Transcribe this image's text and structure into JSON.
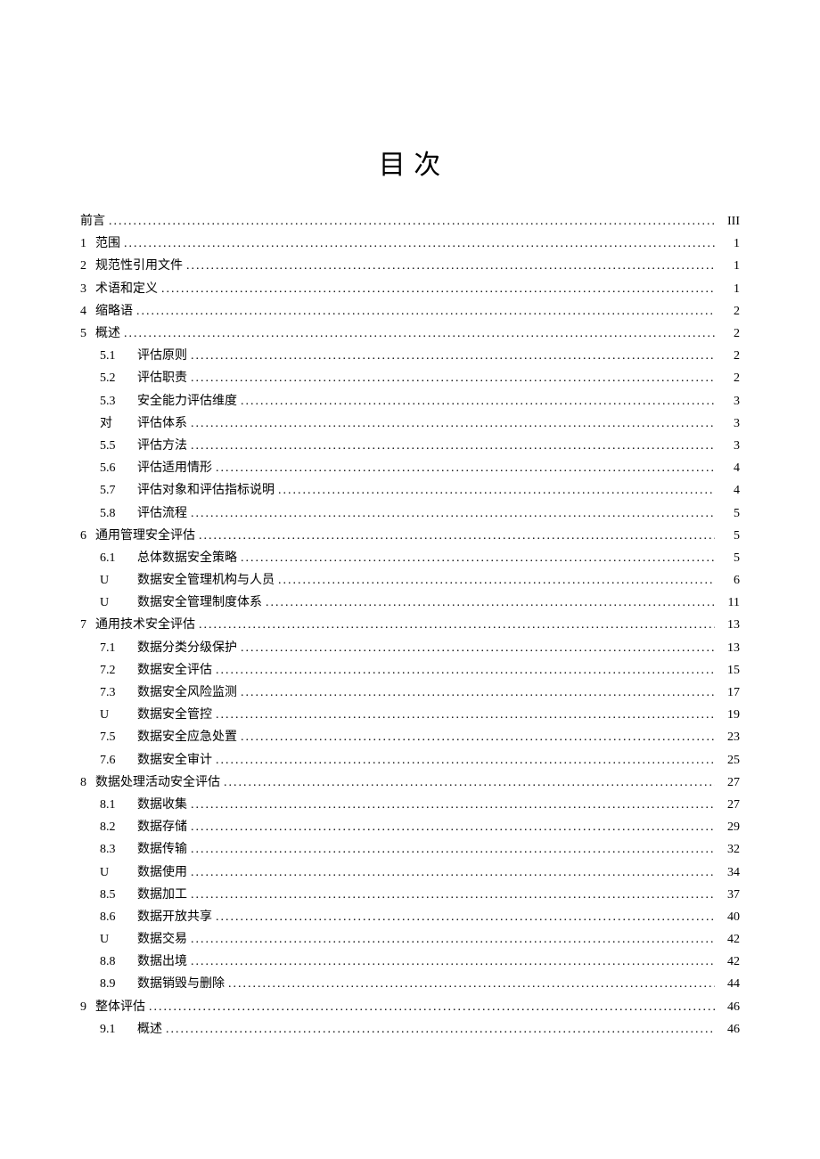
{
  "title": "目 次",
  "toc": [
    {
      "num": "",
      "label": "前言",
      "page": "III",
      "indent": 1
    },
    {
      "num": "1",
      "label": "范围",
      "page": "1",
      "indent": 1
    },
    {
      "num": "2",
      "label": "规范性引用文件",
      "page": "1",
      "indent": 1
    },
    {
      "num": "3",
      "label": "术语和定义",
      "page": "1",
      "indent": 1
    },
    {
      "num": "4",
      "label": "缩略语",
      "page": "2",
      "indent": 1
    },
    {
      "num": "5",
      "label": "概述",
      "page": "2",
      "indent": 1
    },
    {
      "num": "5.1",
      "label": "评估原则",
      "page": "2",
      "indent": 2
    },
    {
      "num": "5.2",
      "label": "评估职责",
      "page": "2",
      "indent": 2
    },
    {
      "num": "5.3",
      "label": "安全能力评估维度",
      "page": "3",
      "indent": 2
    },
    {
      "num": "对",
      "label": "评估体系",
      "page": "3",
      "indent": 2
    },
    {
      "num": "5.5",
      "label": "评估方法",
      "page": "3",
      "indent": 2
    },
    {
      "num": "5.6",
      "label": "评估适用情形",
      "page": "4",
      "indent": 2
    },
    {
      "num": "5.7",
      "label": "评估对象和评估指标说明",
      "page": "4",
      "indent": 2
    },
    {
      "num": "5.8",
      "label": "评估流程",
      "page": "5",
      "indent": 2
    },
    {
      "num": "6",
      "label": "通用管理安全评估",
      "page": "5",
      "indent": 1
    },
    {
      "num": "6.1",
      "label": "总体数据安全策略",
      "page": "5",
      "indent": 2
    },
    {
      "num": "U",
      "label": "数据安全管理机构与人员",
      "page": "6",
      "indent": 2
    },
    {
      "num": "U",
      "label": "数据安全管理制度体系",
      "page": "11",
      "indent": 2
    },
    {
      "num": "7",
      "label": "通用技术安全评估",
      "page": "13",
      "indent": 1
    },
    {
      "num": "7.1",
      "label": "数据分类分级保护",
      "page": "13",
      "indent": 2
    },
    {
      "num": "7.2",
      "label": "数据安全评估",
      "page": "15",
      "indent": 2
    },
    {
      "num": "7.3",
      "label": "数据安全风险监测",
      "page": "17",
      "indent": 2
    },
    {
      "num": "U",
      "label": "数据安全管控",
      "page": "19",
      "indent": 2
    },
    {
      "num": "7.5",
      "label": "数据安全应急处置",
      "page": "23",
      "indent": 2
    },
    {
      "num": "7.6",
      "label": "数据安全审计",
      "page": "25",
      "indent": 2
    },
    {
      "num": "8",
      "label": "数据处理活动安全评估",
      "page": "27",
      "indent": 1
    },
    {
      "num": "8.1",
      "label": "数据收集",
      "page": "27",
      "indent": 2
    },
    {
      "num": "8.2",
      "label": "数据存储",
      "page": "29",
      "indent": 2
    },
    {
      "num": "8.3",
      "label": "数据传输",
      "page": "32",
      "indent": 2
    },
    {
      "num": "U",
      "label": "数据使用",
      "page": "34",
      "indent": 2
    },
    {
      "num": "8.5",
      "label": "数据加工",
      "page": "37",
      "indent": 2
    },
    {
      "num": "8.6",
      "label": "数据开放共享",
      "page": "40",
      "indent": 2
    },
    {
      "num": "U",
      "label": "数据交易",
      "page": "42",
      "indent": 2
    },
    {
      "num": "8.8",
      "label": "数据出境",
      "page": "42",
      "indent": 2
    },
    {
      "num": "8.9",
      "label": "数据销毁与删除",
      "page": "44",
      "indent": 2
    },
    {
      "num": "9",
      "label": "整体评估",
      "page": "46",
      "indent": 1
    },
    {
      "num": "9.1",
      "label": "概述",
      "page": "46",
      "indent": 2
    }
  ]
}
